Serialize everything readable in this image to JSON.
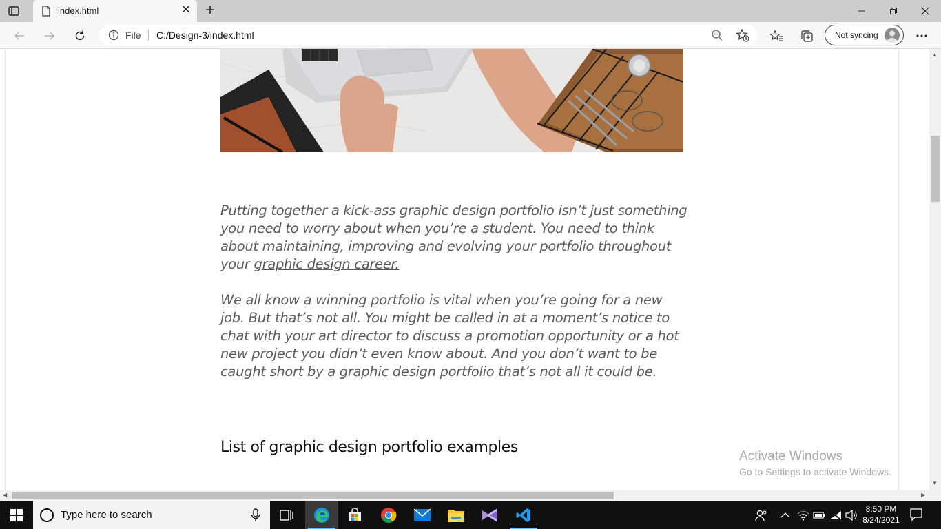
{
  "browser": {
    "tab": {
      "title": "index.html"
    },
    "address": {
      "scheme": "File",
      "url": "C:/Design-3/index.html"
    },
    "profile": {
      "label": "Not syncing"
    }
  },
  "page": {
    "paragraph1": "Putting together a kick-ass graphic design portfolio isn’t just something you need to worry about when you’re a student. You need to think about maintaining, improving and evolving your portfolio throughout your ",
    "paragraph1_link": "graphic design career.",
    "paragraph2": "We all know a winning portfolio is vital when you’re going for a new job. But that’s not all. You might be called in at a moment’s notice to chat with your art director to discuss a promotion opportunity or a hot new project you didn’t even know about. And you don’t want to be caught short by a graphic design portfolio that’s not all it could be.",
    "heading": "List of graphic design portfolio examples"
  },
  "watermark": {
    "line1": "Activate Windows",
    "line2": "Go to Settings to activate Windows."
  },
  "taskbar": {
    "search_placeholder": "Type here to search",
    "time": "8:50 PM",
    "date": "8/24/2021",
    "apps": [
      "task-view",
      "edge",
      "microsoft-store",
      "chrome",
      "mail",
      "file-explorer",
      "visual-studio",
      "vs-code"
    ]
  }
}
